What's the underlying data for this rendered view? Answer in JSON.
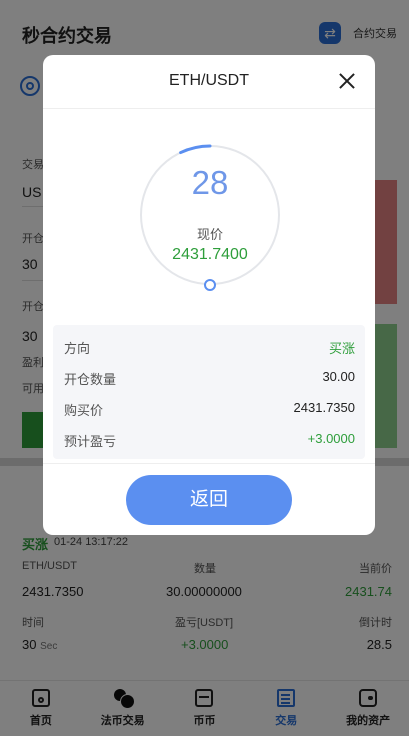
{
  "header": {
    "title": "秒合约交易",
    "switch_label": "合约交易",
    "switch_icon": "swap-icon"
  },
  "background_form": {
    "labels": [
      "交易",
      "开仓",
      "开仓"
    ],
    "values": [
      "US",
      "30",
      "30"
    ],
    "extra_labels": [
      "盈利",
      "可用"
    ]
  },
  "order": {
    "direction": "买涨",
    "time": "01-24 13:17:22",
    "col1_label": "ETH/USDT",
    "col2_label": "数量",
    "col3_label": "当前价",
    "col1_value": "2431.7350",
    "col2_value": "30.00000000",
    "col3_value": "2431.74",
    "col4_label": "时间",
    "col5_label": "盈亏[USDT]",
    "col6_label": "倒计时",
    "col4_value": "30",
    "col4_unit": "Sec",
    "col5_value": "+3.0000",
    "col6_value": "28.5"
  },
  "tabbar": {
    "items": [
      {
        "label": "首页",
        "icon": "home-icon"
      },
      {
        "label": "法币交易",
        "icon": "coins-icon"
      },
      {
        "label": "币币",
        "icon": "folder-icon"
      },
      {
        "label": "交易",
        "icon": "trade-icon",
        "active": true
      },
      {
        "label": "我的资产",
        "icon": "wallet-icon"
      }
    ]
  },
  "modal": {
    "title": "ETH/USDT",
    "countdown": "28",
    "countdown_progress": 0.07,
    "price_label": "现价",
    "price_value": "2431.7400",
    "rows": [
      {
        "label": "方向",
        "value": "买涨"
      },
      {
        "label": "开仓数量",
        "value": "30.00"
      },
      {
        "label": "购买价",
        "value": "2431.7350"
      },
      {
        "label": "预计盈亏",
        "value": "+3.0000"
      }
    ],
    "back_label": "返回"
  },
  "colors": {
    "accent": "#5b8ff0",
    "green": "#2e9e3b",
    "red": "#e48383"
  }
}
